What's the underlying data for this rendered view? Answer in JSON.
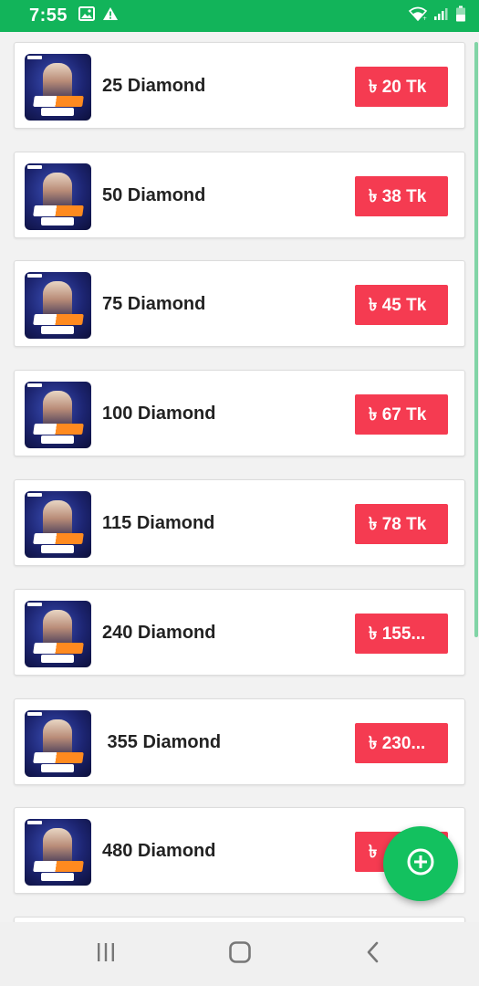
{
  "status_bar": {
    "time": "7:55",
    "background": "#12b45a",
    "left_icons": [
      "image-icon",
      "warning-icon"
    ],
    "right_icons": [
      "wifi-icon",
      "signal-icon",
      "battery-icon"
    ]
  },
  "products": [
    {
      "label": "25 Diamond",
      "price": "৳ 20 Tk"
    },
    {
      "label": "50 Diamond",
      "price": "৳ 38 Tk"
    },
    {
      "label": "75 Diamond",
      "price": "৳ 45 Tk"
    },
    {
      "label": "100 Diamond",
      "price": "৳ 67 Tk"
    },
    {
      "label": "115 Diamond",
      "price": "৳ 78 Tk"
    },
    {
      "label": "240 Diamond",
      "price": "৳ 155..."
    },
    {
      "label": " 355 Diamond",
      "price": "৳ 230..."
    },
    {
      "label": "480 Diamond",
      "price": "৳ "
    }
  ],
  "colors": {
    "accent": "#12b45a",
    "price_button": "#f53b51",
    "fab": "#13c15f"
  },
  "fab": {
    "icon": "add-circle-icon"
  },
  "nav_bar": {
    "icons": [
      "recent-apps-icon",
      "home-icon",
      "back-icon"
    ]
  }
}
